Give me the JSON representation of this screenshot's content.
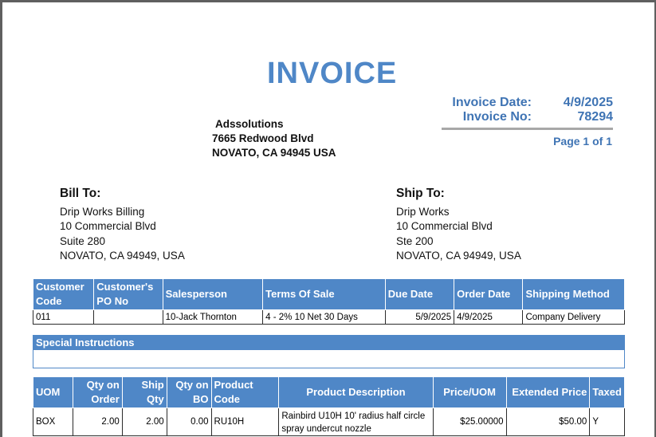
{
  "invoice": {
    "title": "INVOICE",
    "date_label": "Invoice Date:",
    "date_value": "4/9/2025",
    "no_label": "Invoice No:",
    "no_value": "78294",
    "page_text": "Page 1 of 1"
  },
  "company": {
    "name": "Adssolutions",
    "street": "7665 Redwood Blvd",
    "city": "NOVATO, CA 94945 USA"
  },
  "bill_to": {
    "heading": "Bill To:",
    "line1": "Drip Works Billing",
    "line2": "10 Commercial Blvd",
    "line3": "Suite 280",
    "line4": "NOVATO, CA 94949, USA"
  },
  "ship_to": {
    "heading": "Ship To:",
    "line1": "Drip Works",
    "line2": "10 Commercial Blvd",
    "line3": "Ste 200",
    "line4": "NOVATO, CA 94949, USA"
  },
  "order": {
    "headers": [
      "Customer Code",
      "Customer's PO No",
      "Salesperson",
      "Terms Of Sale",
      "Due Date",
      "Order Date",
      "Shipping Method"
    ],
    "row": [
      "011",
      "",
      "10-Jack Thornton",
      "4 - 2% 10 Net 30 Days",
      "5/9/2025",
      "4/9/2025",
      "Company Delivery"
    ]
  },
  "special": {
    "heading": "Special Instructions",
    "text": ""
  },
  "lines": {
    "headers": [
      "UOM",
      "Qty on Order",
      "Ship Qty",
      "Qty on BO",
      "Product Code",
      "Product Description",
      "Price/UOM",
      "Extended Price",
      "Taxed"
    ],
    "rows": [
      [
        "BOX",
        "2.00",
        "2.00",
        "0.00",
        "RU10H",
        "Rainbird U10H 10' radius half circle spray undercut nozzle",
        "$25.00000",
        "$50.00",
        "Y"
      ]
    ]
  }
}
